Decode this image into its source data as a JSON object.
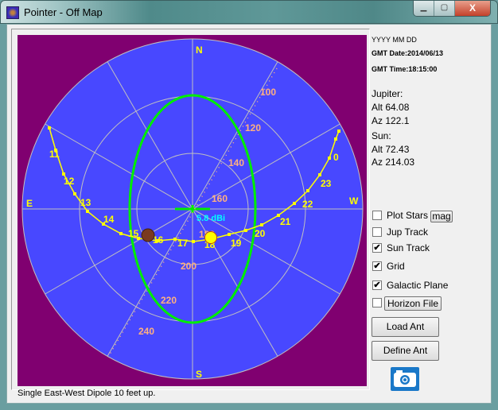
{
  "window": {
    "title": "Pointer - Off Map",
    "minimize": "▁",
    "maximize": "▢",
    "close": "X"
  },
  "info": {
    "date_format": "YYYY MM DD",
    "gmt_date": "GMT Date:2014/06/13",
    "gmt_time": "GMT Time:18:15:00",
    "jupiter": {
      "label": "Jupiter:",
      "alt": "Alt 64.08",
      "az": "Az 122.1"
    },
    "sun": {
      "label": "Sun:",
      "alt": "Alt 72.43",
      "az": "Az 214.03"
    }
  },
  "options": [
    {
      "label": "Plot Stars",
      "checked": false
    },
    {
      "label": "Jup Track",
      "checked": false
    },
    {
      "label": "Sun Track",
      "checked": true
    },
    {
      "label": "Grid",
      "checked": true
    },
    {
      "label": "Galactic Plane",
      "checked": true
    },
    {
      "label": "",
      "checked": false
    }
  ],
  "buttons": {
    "mag": "mag",
    "horizon_file": "Horizon File",
    "load_ant": "Load Ant",
    "define_ant": "Define Ant",
    "camera": "camera-icon"
  },
  "status": "Single East-West Dipole 10 feet up.",
  "plot": {
    "compass": {
      "n": "N",
      "s": "S",
      "e": "E",
      "w": "W"
    },
    "gain": "5.8 dBi",
    "sun_track_hours": [
      "11",
      "12",
      "13",
      "14",
      "15",
      "16",
      "17",
      "18",
      "19",
      "20",
      "21",
      "22",
      "23",
      "0"
    ],
    "pointer_labels": [
      "100",
      "120",
      "140",
      "160",
      "180",
      "200",
      "220",
      "240"
    ],
    "colors": {
      "background": "#800070",
      "sky": "#4848ff",
      "grid": "#c0c0c0",
      "track": "#ffff00",
      "galactic": "#00ee00",
      "pointer": "#ffb080",
      "gain": "#00ffff"
    }
  }
}
